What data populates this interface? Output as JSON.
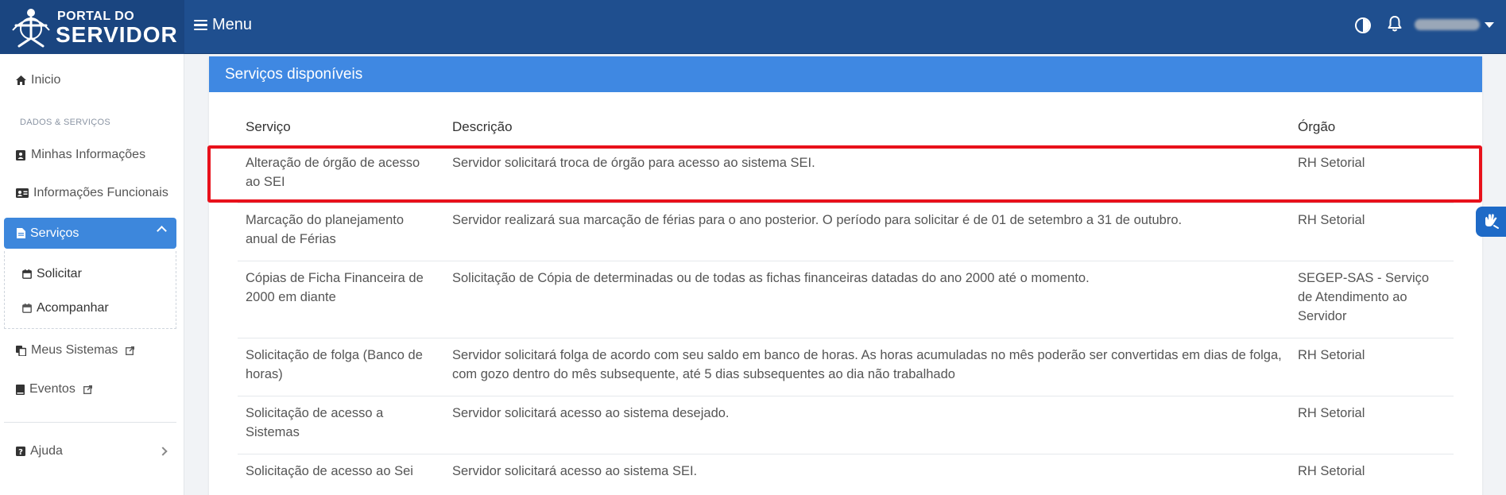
{
  "header": {
    "logo_line1": "PORTAL DO",
    "logo_line2": "SERVIDOR",
    "menu_label": "Menu"
  },
  "sidebar": {
    "inicio": "Inicio",
    "section": "DADOS & SERVIÇOS",
    "minhas_informacoes": "Minhas Informações",
    "informacoes_funcionais": "Informações Funcionais",
    "servicos": "Serviços",
    "solicitar": "Solicitar",
    "acompanhar": "Acompanhar",
    "meus_sistemas": "Meus Sistemas",
    "eventos": "Eventos",
    "ajuda": "Ajuda"
  },
  "card": {
    "title": "Serviços disponíveis",
    "columns": [
      "Serviço",
      "Descrição",
      "Órgão"
    ],
    "rows": [
      {
        "servico": "Alteração de órgão de acesso ao SEI",
        "descricao": "Servidor solicitará troca de órgão para acesso ao sistema SEI.",
        "orgao": "RH Setorial"
      },
      {
        "servico": "Marcação do planejamento anual de Férias",
        "descricao": "Servidor realizará sua marcação de férias para o ano posterior. O período para solicitar é de 01 de setembro a 31 de outubro.",
        "orgao": "RH Setorial"
      },
      {
        "servico": "Cópias de Ficha Financeira de 2000 em diante",
        "descricao": "Solicitação de Cópia de determinadas ou de todas as fichas financeiras datadas do ano 2000 até o momento.",
        "orgao": "SEGEP-SAS - Serviço de Atendimento ao Servidor"
      },
      {
        "servico": "Solicitação de folga (Banco de horas)",
        "descricao": "Servidor solicitará folga de acordo com seu saldo em banco de horas. As horas acumuladas no mês poderão ser convertidas em dias de folga, com gozo dentro do mês subsequente, até 5 dias subsequentes ao dia não trabalhado",
        "orgao": "RH Setorial"
      },
      {
        "servico": "Solicitação de acesso a Sistemas",
        "descricao": "Servidor solicitará acesso ao sistema desejado.",
        "orgao": "RH Setorial"
      },
      {
        "servico": "Solicitação de acesso ao Sei",
        "descricao": "Servidor solicitará acesso ao sistema SEI.",
        "orgao": "RH Setorial"
      }
    ]
  },
  "colors": {
    "topbar": "#1f4f8f",
    "accent": "#3f88e2",
    "highlight": "#e8111b"
  },
  "icons": [
    "home-icon",
    "id-card-icon",
    "address-card-icon",
    "file-icon",
    "calendar-icon",
    "copy-icon",
    "book-icon",
    "external-link-icon",
    "question-icon",
    "contrast-icon",
    "bell-icon",
    "sign-language-icon"
  ]
}
